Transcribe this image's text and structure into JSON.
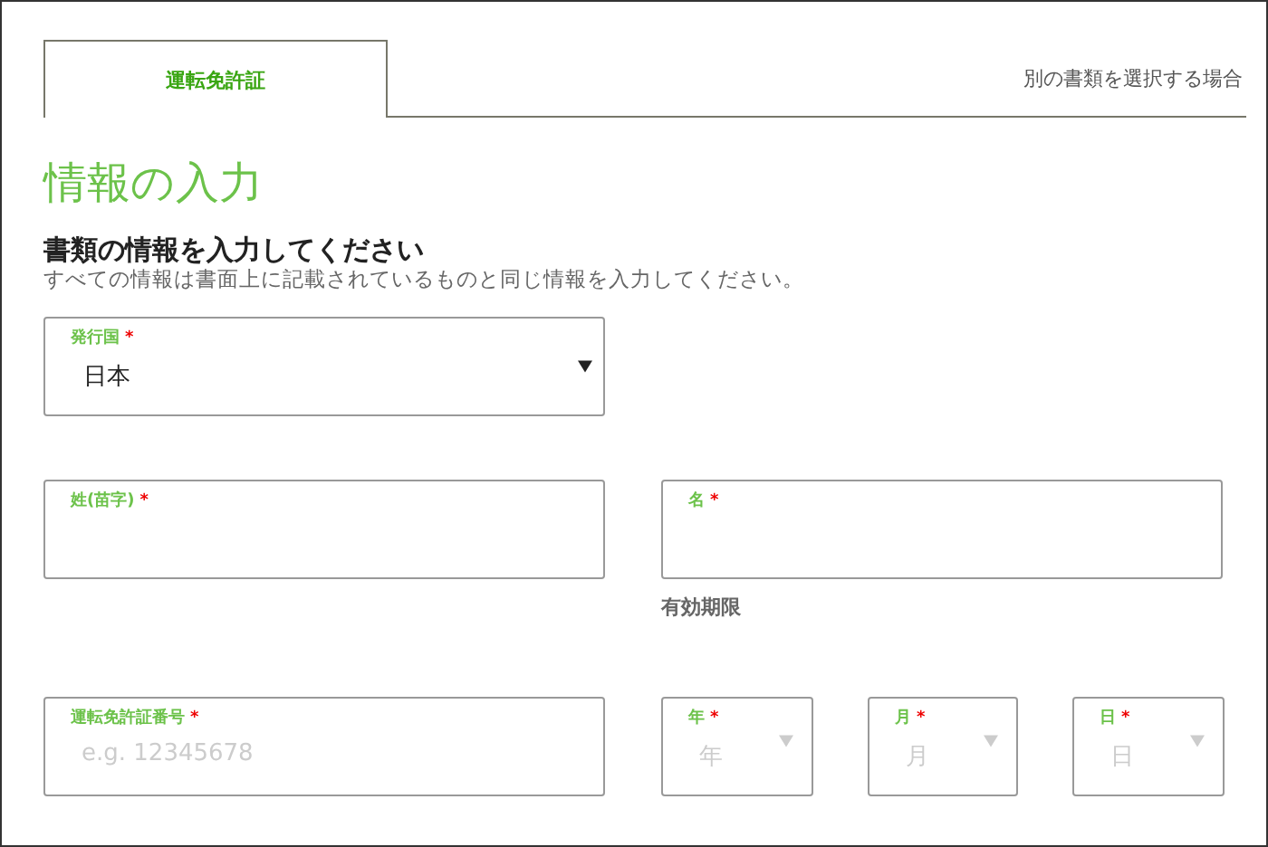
{
  "tabs": [
    {
      "label": "運転免許証",
      "selected": true
    }
  ],
  "other_document_link": "別の書類を選択する場合",
  "title": "情報の入力",
  "heading": "書類の情報を入力してください",
  "subtitle": "すべての情報は書面上に記載されているものと同じ情報を入力してください。",
  "country": {
    "label": "発行国",
    "required_mark": "*",
    "value": "日本"
  },
  "last_name": {
    "label": "姓(苗字)",
    "required_mark": "*"
  },
  "first_name": {
    "label": "名",
    "required_mark": "*"
  },
  "expiry_label": "有効期限",
  "license_number": {
    "label": "運転免許証番号",
    "required_mark": "*",
    "placeholder": "e.g. 12345678"
  },
  "expiry": [
    {
      "label": "年",
      "required_mark": "*",
      "placeholder": "年"
    },
    {
      "label": "月",
      "required_mark": "*",
      "placeholder": "月"
    },
    {
      "label": "日",
      "required_mark": "*",
      "placeholder": "日"
    }
  ]
}
